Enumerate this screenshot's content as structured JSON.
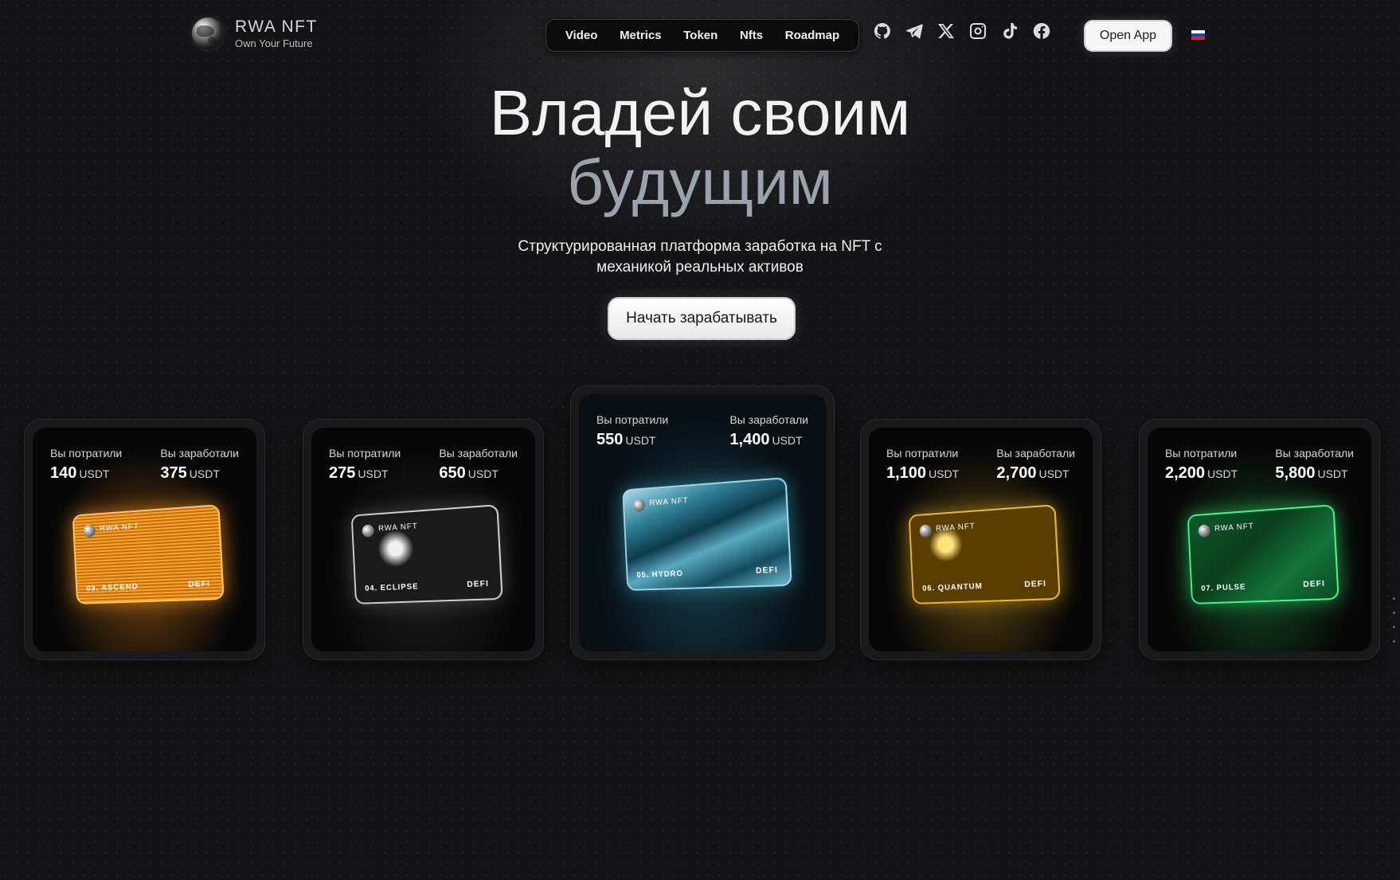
{
  "brand": {
    "title": "RWA NFT",
    "tagline": "Own Your Future"
  },
  "nav": [
    {
      "label": "Video"
    },
    {
      "label": "Metrics"
    },
    {
      "label": "Token"
    },
    {
      "label": "Nfts"
    },
    {
      "label": "Roadmap"
    }
  ],
  "socials": [
    {
      "icon": "github-icon"
    },
    {
      "icon": "telegram-icon"
    },
    {
      "icon": "x-icon"
    },
    {
      "icon": "instagram-icon"
    },
    {
      "icon": "tiktok-icon"
    },
    {
      "icon": "facebook-icon"
    }
  ],
  "header": {
    "open_app_label": "Open App",
    "language_icon": "russia-flag-icon"
  },
  "hero": {
    "line1": "Владей своим",
    "line2": "будущим",
    "subtitle_line1": "Структурированная платформа заработка на NFT с",
    "subtitle_line2": "механикой реальных активов",
    "cta_label": "Начать зарабатывать"
  },
  "cards": [
    {
      "spent_label": "Вы потратили",
      "spent": "140",
      "earned_label": "Вы заработали",
      "earned": "375",
      "unit": "USDT",
      "nft_brand": "RWA NFT",
      "nft_name": "03. ASCEND",
      "nft_tag": "DEFI",
      "accent": "#f08a1c"
    },
    {
      "spent_label": "Вы потратили",
      "spent": "275",
      "earned_label": "Вы заработали",
      "earned": "650",
      "unit": "USDT",
      "nft_brand": "RWA NFT",
      "nft_name": "04. ECLIPSE",
      "nft_tag": "DEFI",
      "accent": "#9a9a9a"
    },
    {
      "spent_label": "Вы потратили",
      "spent": "550",
      "earned_label": "Вы заработали",
      "earned": "1,400",
      "unit": "USDT",
      "nft_brand": "RWA NFT",
      "nft_name": "05. HYDRO",
      "nft_tag": "DEFI",
      "accent": "#3aa6c9"
    },
    {
      "spent_label": "Вы потратили",
      "spent": "1,100",
      "earned_label": "Вы заработали",
      "earned": "2,700",
      "unit": "USDT",
      "nft_brand": "RWA NFT",
      "nft_name": "06. QUANTUM",
      "nft_tag": "DEFI",
      "accent": "#d9a21a"
    },
    {
      "spent_label": "Вы потратили",
      "spent": "2,200",
      "earned_label": "Вы заработали",
      "earned": "5,800",
      "unit": "USDT",
      "nft_brand": "RWA NFT",
      "nft_name": "07. PULSE",
      "nft_tag": "DEFI",
      "accent": "#27c95a"
    }
  ]
}
